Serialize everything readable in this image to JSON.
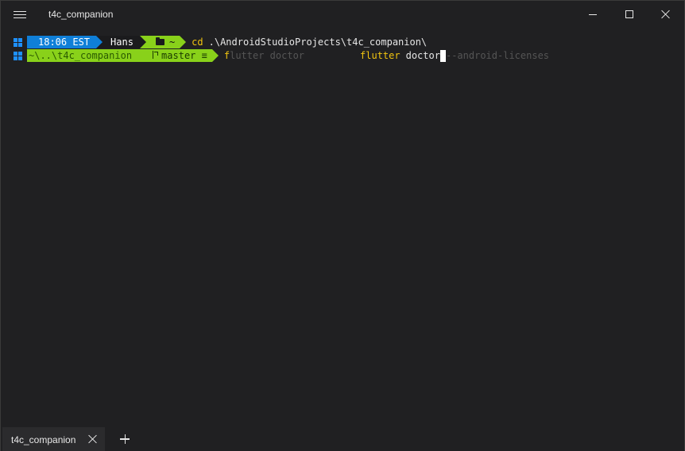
{
  "window": {
    "title": "t4c_companion"
  },
  "prompt1": {
    "time": "18:06 EST",
    "user": "Hans",
    "folder": "~",
    "command": "cd",
    "argument": ".\\AndroidStudioProjects\\t4c_companion\\"
  },
  "prompt2": {
    "path": "~\\..\\t4c_companion",
    "branch": "master",
    "branch_status": "≡",
    "typed_first_char": "f",
    "ghost_prefix": "lutter doctor",
    "cmd_word": "flutter",
    "arg_word": "doctor",
    "ghost_suffix": "--android-licenses"
  },
  "tabs": [
    {
      "label": "t4c_companion"
    }
  ],
  "colors": {
    "background": "#202022",
    "time_segment": "#0f7fd8",
    "folder_segment": "#89d11a",
    "command_yellow": "#f1c40f",
    "ghost_text": "#555555"
  },
  "icons": {
    "menu": "hamburger-icon",
    "windows": "windows-logo-icon",
    "folder": "folder-icon",
    "branch": "git-branch-icon"
  }
}
